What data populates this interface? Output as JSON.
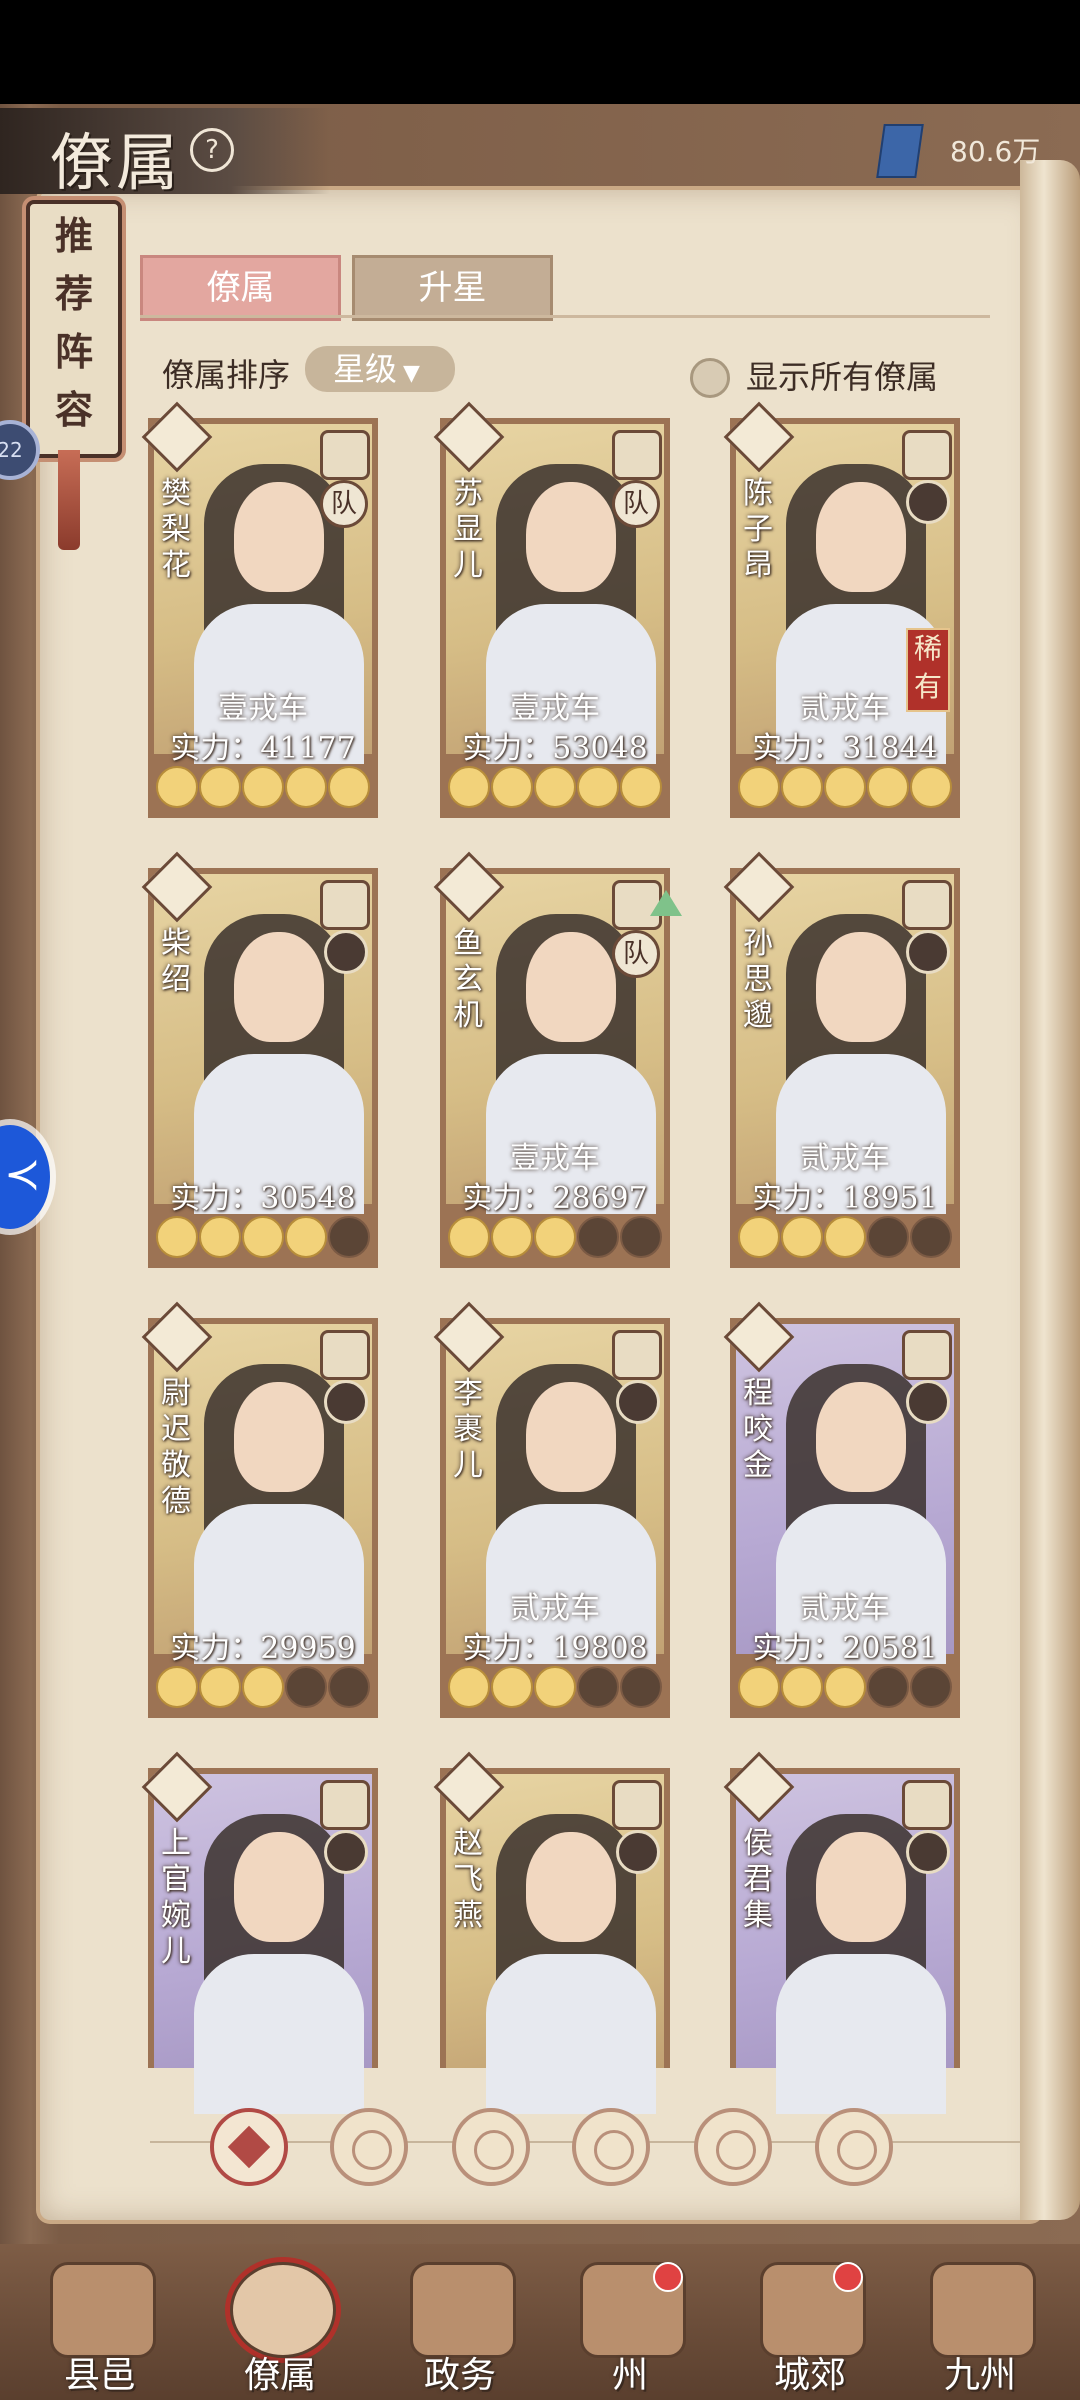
{
  "header": {
    "title": "僚属",
    "help": "?",
    "currency_value": "80.6万",
    "currency_icon": "book-icon"
  },
  "side": {
    "recommend_label": [
      "推",
      "荐",
      "阵",
      "容"
    ],
    "badge_text": "22"
  },
  "tabs": [
    {
      "label": "僚属",
      "active": true
    },
    {
      "label": "升星",
      "active": false
    }
  ],
  "sort": {
    "label": "僚属排序",
    "selected": "星级"
  },
  "show_all_label": "显示所有僚属",
  "cards": [
    {
      "name": "樊梨花",
      "vehicle": "壹戎车",
      "power": "实力：41177",
      "stars_on": 5,
      "rare": "",
      "dui": "队",
      "purple": false
    },
    {
      "name": "苏显儿",
      "vehicle": "壹戎车",
      "power": "实力：53048",
      "stars_on": 5,
      "rare": "",
      "dui": "队",
      "purple": false
    },
    {
      "name": "陈子昂",
      "vehicle": "贰戎车",
      "power": "实力：31844",
      "stars_on": 5,
      "rare": "稀有",
      "dui": "",
      "purple": false
    },
    {
      "name": "柴绍",
      "vehicle": "",
      "power": "实力：30548",
      "stars_on": 4,
      "rare": "",
      "dui": "",
      "purple": false
    },
    {
      "name": "鱼玄机",
      "vehicle": "壹戎车",
      "power": "实力：28697",
      "stars_on": 3,
      "rare": "",
      "dui": "队",
      "purple": false
    },
    {
      "name": "孙思邈",
      "vehicle": "贰戎车",
      "power": "实力：18951",
      "stars_on": 3,
      "rare": "",
      "dui": "",
      "purple": false
    },
    {
      "name": "尉迟敬德",
      "vehicle": "",
      "power": "实力：29959",
      "stars_on": 3,
      "rare": "",
      "dui": "",
      "purple": false
    },
    {
      "name": "李裹儿",
      "vehicle": "贰戎车",
      "power": "实力：19808",
      "stars_on": 3,
      "rare": "",
      "dui": "",
      "purple": false
    },
    {
      "name": "程咬金",
      "vehicle": "贰戎车",
      "power": "实力：20581",
      "stars_on": 3,
      "rare": "",
      "dui": "",
      "purple": true
    },
    {
      "name": "上官婉儿",
      "vehicle": "",
      "power": "",
      "stars_on": 0,
      "rare": "",
      "dui": "",
      "purple": true
    },
    {
      "name": "赵飞燕",
      "vehicle": "",
      "power": "",
      "stars_on": 0,
      "rare": "",
      "dui": "",
      "purple": false
    },
    {
      "name": "侯君集",
      "vehicle": "",
      "power": "",
      "stars_on": 0,
      "rare": "",
      "dui": "",
      "purple": true
    }
  ],
  "filters": [
    "all-filter-icon",
    "bell-filter-icon",
    "cat-filter-icon",
    "fan-filter-icon",
    "lion-filter-icon",
    "mask-filter-icon"
  ],
  "nav": [
    {
      "label": "县邑",
      "dot": false
    },
    {
      "label": "僚属",
      "dot": false
    },
    {
      "label": "政务",
      "dot": false
    },
    {
      "label": "州",
      "dot": true
    },
    {
      "label": "城郊",
      "dot": true
    },
    {
      "label": "九州",
      "dot": false
    }
  ],
  "colors": {
    "accent_red": "#b14a45",
    "tab_active": "#e3a7a0",
    "star_on": "#f2d27a"
  }
}
